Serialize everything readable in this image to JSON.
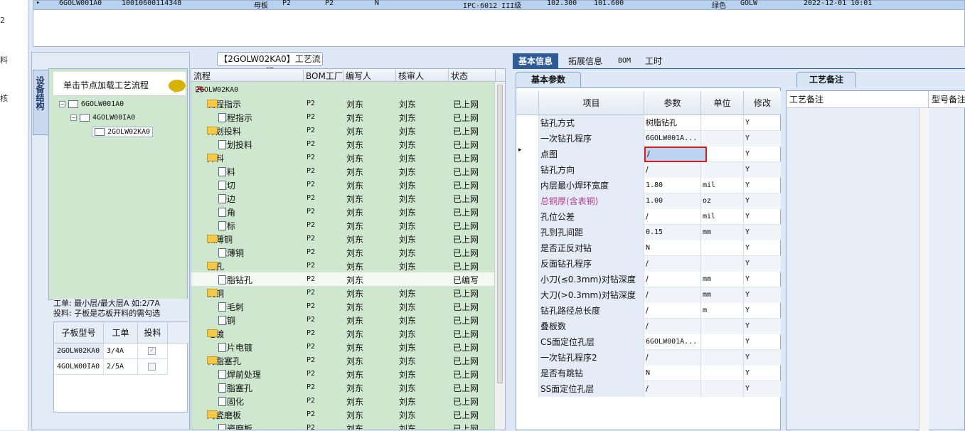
{
  "left_edge": [
    "2",
    "料",
    "核"
  ],
  "top_row": {
    "code": "6GOLW001A0",
    "id": "10010600114348",
    "type": "母板",
    "p1": "P2",
    "p2": "P2",
    "n": "N",
    "grade": "IPC-6012 III级",
    "v1": "102.300",
    "v2": "101.600",
    "color": "绿色",
    "brand": "GOLW",
    "date": "2022-12-01 10:01"
  },
  "left_panel": {
    "vtab_label": "设备结构",
    "header_text": "单击节点加载工艺流程",
    "tree": [
      "6GOLW001A0",
      "4GOLW00IA0",
      "2GOLW02KA0"
    ],
    "note_line1": "工单: 最小层/最大层A 如:2/7A",
    "note_line2": "投料: 子板是芯板开料的需勾选",
    "sub_headers": [
      "子板型号",
      "工单",
      "投料"
    ],
    "sub_rows": [
      {
        "model": "2GOLW02KA0",
        "order": "3/4A",
        "checked": true
      },
      {
        "model": "4GOLW00IA0",
        "order": "2/5A",
        "checked": false
      }
    ]
  },
  "process": {
    "title": "【2GOLW02KA0】工艺流程",
    "headers": [
      "流程",
      "BOM工厂",
      "编写人",
      "核审人",
      "状态"
    ],
    "root": "2GOLW02KA0",
    "rows": [
      {
        "label": "流程指示",
        "level": 1,
        "bom": "P2",
        "writer": "刘东",
        "reviewer": "刘东",
        "status": "已上网"
      },
      {
        "label": "流程指示",
        "level": 2,
        "bom": "P2",
        "writer": "刘东",
        "reviewer": "刘东",
        "status": "已上网"
      },
      {
        "label": "计划投料",
        "level": 1,
        "bom": "P2",
        "writer": "刘东",
        "reviewer": "刘东",
        "status": "已上网"
      },
      {
        "label": "计划投料",
        "level": 2,
        "bom": "P2",
        "writer": "刘东",
        "reviewer": "刘东",
        "status": "已上网"
      },
      {
        "label": "开料",
        "level": 1,
        "bom": "P2",
        "writer": "刘东",
        "reviewer": "刘东",
        "status": "已上网"
      },
      {
        "label": "开料",
        "level": 2,
        "bom": "P2",
        "writer": "刘东",
        "reviewer": "刘东",
        "status": "已上网"
      },
      {
        "label": "裁切",
        "level": 2,
        "bom": "P2",
        "writer": "刘东",
        "reviewer": "刘东",
        "status": "已上网"
      },
      {
        "label": "磨边",
        "level": 2,
        "bom": "P2",
        "writer": "刘东",
        "reviewer": "刘东",
        "status": "已上网"
      },
      {
        "label": "圆角",
        "level": 2,
        "bom": "P2",
        "writer": "刘东",
        "reviewer": "刘东",
        "status": "已上网"
      },
      {
        "label": "打标",
        "level": 2,
        "bom": "P2",
        "writer": "刘东",
        "reviewer": "刘东",
        "status": "已上网"
      },
      {
        "label": "减薄铜",
        "level": 1,
        "bom": "P2",
        "writer": "刘东",
        "reviewer": "刘东",
        "status": "已上网"
      },
      {
        "label": "减薄铜",
        "level": 2,
        "bom": "P2",
        "writer": "刘东",
        "reviewer": "刘东",
        "status": "已上网"
      },
      {
        "label": "钻孔",
        "level": 1,
        "bom": "P2",
        "writer": "刘东",
        "reviewer": "刘东",
        "status": "已上网"
      },
      {
        "label": "树脂钻孔",
        "level": 2,
        "bom": "P2",
        "writer": "刘东",
        "reviewer": "",
        "status": "已编写",
        "highlight": true
      },
      {
        "label": "沉铜",
        "level": 1,
        "bom": "P2",
        "writer": "刘东",
        "reviewer": "刘东",
        "status": "已上网"
      },
      {
        "label": "去毛刺",
        "level": 2,
        "bom": "P2",
        "writer": "刘东",
        "reviewer": "刘东",
        "status": "已上网"
      },
      {
        "label": "沉铜",
        "level": 2,
        "bom": "P2",
        "writer": "刘东",
        "reviewer": "刘东",
        "status": "已上网"
      },
      {
        "label": "电镀",
        "level": 1,
        "bom": "P2",
        "writer": "刘东",
        "reviewer": "刘东",
        "status": "已上网"
      },
      {
        "label": "负片电镀",
        "level": 2,
        "bom": "P2",
        "writer": "刘东",
        "reviewer": "刘东",
        "status": "已上网"
      },
      {
        "label": "树脂塞孔",
        "level": 1,
        "bom": "P2",
        "writer": "刘东",
        "reviewer": "刘东",
        "status": "已上网"
      },
      {
        "label": "阻焊前处理",
        "level": 2,
        "bom": "P2",
        "writer": "刘东",
        "reviewer": "刘东",
        "status": "已上网"
      },
      {
        "label": "树脂塞孔",
        "level": 2,
        "bom": "P2",
        "writer": "刘东",
        "reviewer": "刘东",
        "status": "已上网"
      },
      {
        "label": "终固化",
        "level": 2,
        "bom": "P2",
        "writer": "刘东",
        "reviewer": "刘东",
        "status": "已上网"
      },
      {
        "label": "陶瓷磨板",
        "level": 1,
        "bom": "P2",
        "writer": "刘东",
        "reviewer": "刘东",
        "status": "已上网"
      },
      {
        "label": "陶瓷磨板",
        "level": 2,
        "bom": "P2",
        "writer": "刘东",
        "reviewer": "刘东",
        "status": "已上网"
      }
    ]
  },
  "tabs": [
    "基本信息",
    "拓展信息",
    "BOM",
    "工时"
  ],
  "basic_tab": "基本参数",
  "remark_tab": "工艺备注",
  "param_headers": [
    "项目",
    "参数",
    "单位",
    "修改"
  ],
  "params": [
    {
      "name": "钻孔方式",
      "value": "树脂钻孔",
      "unit": "",
      "mod": "Y"
    },
    {
      "name": "一次钻孔程序",
      "value": "6GOLW001A...",
      "unit": "",
      "mod": "Y"
    },
    {
      "name": "点图",
      "value": "/",
      "unit": "",
      "mod": "Y",
      "selected": true
    },
    {
      "name": "钻孔方向",
      "value": "/",
      "unit": "",
      "mod": "Y"
    },
    {
      "name": "内层最小焊环宽度",
      "value": "1.80",
      "unit": "mil",
      "mod": "Y"
    },
    {
      "name": "总铜厚(含表铜)",
      "value": "1.00",
      "unit": "oz",
      "mod": "Y",
      "highlight": true
    },
    {
      "name": "孔位公差",
      "value": "/",
      "unit": "mil",
      "mod": "Y"
    },
    {
      "name": "孔到孔间距",
      "value": "0.15",
      "unit": "mm",
      "mod": "Y"
    },
    {
      "name": "是否正反对钻",
      "value": "N",
      "unit": "",
      "mod": "Y"
    },
    {
      "name": "反面钻孔程序",
      "value": "/",
      "unit": "",
      "mod": "Y"
    },
    {
      "name": "小刀(≤0.3mm)对钻深度",
      "value": "/",
      "unit": "mm",
      "mod": "Y"
    },
    {
      "name": "大刀(>0.3mm)对钻深度",
      "value": "/",
      "unit": "mm",
      "mod": "Y"
    },
    {
      "name": "钻孔路径总长度",
      "value": "/",
      "unit": "m",
      "mod": "Y"
    },
    {
      "name": "叠板数",
      "value": "/",
      "unit": "",
      "mod": "Y"
    },
    {
      "name": "CS面定位孔层",
      "value": "6GOLW001A...",
      "unit": "",
      "mod": "Y"
    },
    {
      "name": "一次钻孔程序2",
      "value": "/",
      "unit": "",
      "mod": "Y"
    },
    {
      "name": "是否有跳钻",
      "value": "N",
      "unit": "",
      "mod": "Y"
    },
    {
      "name": "SS面定位孔层",
      "value": "/",
      "unit": "",
      "mod": "Y"
    }
  ],
  "remark_headers": [
    "工艺备注",
    "型号备注"
  ],
  "colors": {
    "accent": "#2d5b98",
    "tree_bg": "#cfe6cf",
    "highlight_text": "#b03a8c",
    "selection_border": "#d62020"
  }
}
